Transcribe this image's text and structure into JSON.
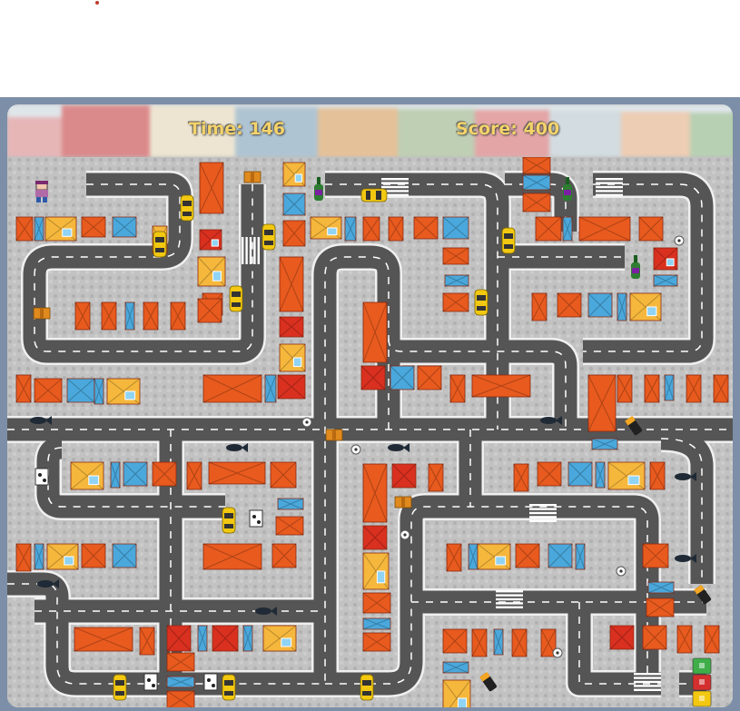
{
  "hud": {
    "time_label": "Time: 146",
    "score_label": "Score: 400"
  },
  "colors": {
    "frame": "#7d8fa8",
    "road": "#555555",
    "road_edge": "#f0f0f0",
    "sidewalk": "#bdbdbd",
    "hud_text": "#f4d36a",
    "roof_red": "#d9301f",
    "roof_orange": "#e85a1e",
    "roof_blue": "#4aa8dc",
    "roof_yellow": "#f5b73c",
    "taxi": "#f2c811"
  },
  "player": {
    "icon": "player-character-icon"
  },
  "items": [
    "battery-icon",
    "wine-bottle-icon",
    "cardboard-box-icon",
    "milk-carton-icon",
    "soccer-ball-icon",
    "dead-fish-icon",
    "taxi-car-icon"
  ],
  "bins": [
    "green-recycling-bin-icon",
    "red-recycling-bin-icon",
    "yellow-recycling-bin-icon"
  ]
}
